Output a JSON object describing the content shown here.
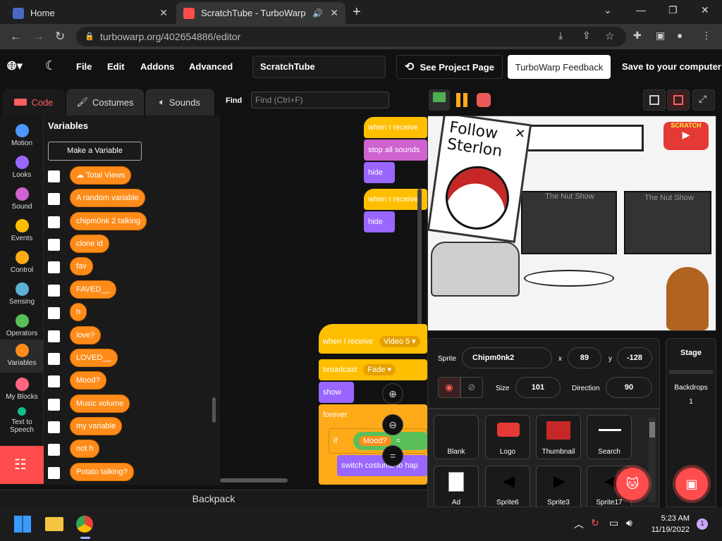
{
  "browser": {
    "tabs": [
      {
        "title": "Home"
      },
      {
        "title": "ScratchTube - TurboWarp"
      }
    ],
    "url": "turbowarp.org/402654886/editor"
  },
  "menubar": {
    "items": [
      "File",
      "Edit",
      "Addons",
      "Advanced"
    ],
    "project_title": "ScratchTube",
    "see_project_page": "See Project Page",
    "feedback": "TurboWarp Feedback",
    "save": "Save to your computer"
  },
  "editor_tabs": {
    "code": "Code",
    "costumes": "Costumes",
    "sounds": "Sounds"
  },
  "find": {
    "label": "Find",
    "placeholder": "Find (Ctrl+F)"
  },
  "categories": [
    {
      "label": "Motion",
      "color": "#4c97ff"
    },
    {
      "label": "Looks",
      "color": "#9966ff"
    },
    {
      "label": "Sound",
      "color": "#cf63cf"
    },
    {
      "label": "Events",
      "color": "#ffbf00"
    },
    {
      "label": "Control",
      "color": "#ffab19"
    },
    {
      "label": "Sensing",
      "color": "#5cb1d6"
    },
    {
      "label": "Operators",
      "color": "#59c059"
    },
    {
      "label": "Variables",
      "color": "#ff8c1a"
    },
    {
      "label": "My Blocks",
      "color": "#ff6680"
    },
    {
      "label": "Text to Speech",
      "color": "#0fbd8c"
    }
  ],
  "palette": {
    "title": "Variables",
    "make_variable": "Make a Variable",
    "variables": [
      "☁ Total Views",
      "A random variable",
      "chipm0nk 2 talking",
      "clone id",
      "fav",
      "FAVED__",
      "h",
      "love?",
      "LOVED__",
      "Mood?",
      "Music volume",
      "my variable",
      "not h",
      "Potato talking?"
    ]
  },
  "script": {
    "when_receive_1": "when I receive",
    "stop_all_sounds": "stop all sounds",
    "hide_1": "hide",
    "when_receive_2": "when I receive",
    "hide_2": "hide",
    "when_receive_3": "when I receive",
    "receive_value": "Video 5",
    "broadcast": "broadcast",
    "broadcast_value": "Fade",
    "show": "show",
    "forever": "forever",
    "if": "if",
    "mood": "Mood?",
    "equals": "=",
    "switch_costume": "switch costume to",
    "costume_value": "hap"
  },
  "backpack": "Backpack",
  "stage": {
    "ad_text": "Follow Sterlon",
    "logo_text": "SCRATCH",
    "thumb1": "The Nut Show",
    "thumb2": "The Nut Show"
  },
  "sprite_info": {
    "sprite_label": "Sprite",
    "sprite_name": "Chipm0nk2",
    "x_label": "x",
    "x_value": "89",
    "y_label": "y",
    "y_value": "-128",
    "size_label": "Size",
    "size_value": "101",
    "direction_label": "Direction",
    "direction_value": "90"
  },
  "sprites": [
    "Blank",
    "Logo",
    "Thumbnail",
    "Search",
    "Ad",
    "Sprite6",
    "Sprite3",
    "Sprite17"
  ],
  "stage_pane": {
    "title": "Stage",
    "backdrops_label": "Backdrops",
    "backdrops_count": "1"
  },
  "taskbar": {
    "time": "5:23 AM",
    "date": "11/19/2022",
    "notifications": "1"
  }
}
